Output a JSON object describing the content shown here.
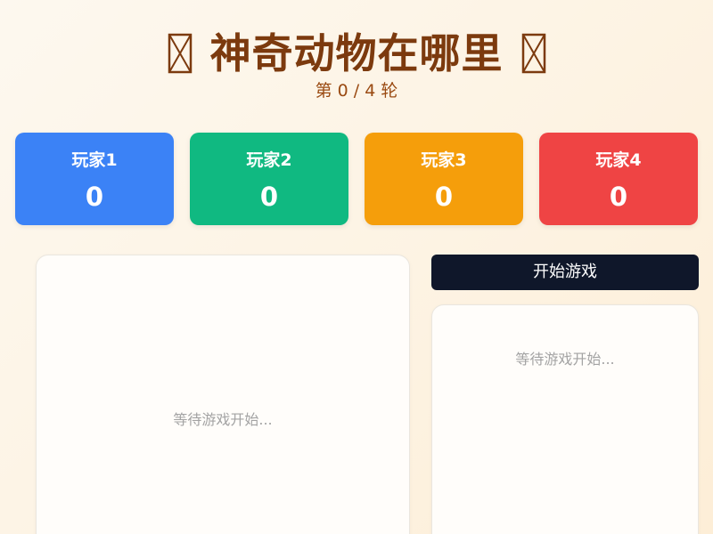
{
  "header": {
    "title": "神奇动物在哪里",
    "icon_left": "missing-glyph-icon",
    "icon_right": "missing-glyph-icon",
    "round_label": "第 0 / 4 轮"
  },
  "players": [
    {
      "name": "玩家1",
      "score": "0",
      "color": "#3b82f6"
    },
    {
      "name": "玩家2",
      "score": "0",
      "color": "#10b981"
    },
    {
      "name": "玩家3",
      "score": "0",
      "color": "#f59e0b"
    },
    {
      "name": "玩家4",
      "score": "0",
      "color": "#ef4444"
    }
  ],
  "board": {
    "waiting_text": "等待游戏开始..."
  },
  "controls": {
    "start_label": "开始游戏"
  },
  "info": {
    "waiting_text": "等待游戏开始..."
  },
  "colors": {
    "title": "#7c3a0e",
    "button_bg": "#0f172a"
  }
}
